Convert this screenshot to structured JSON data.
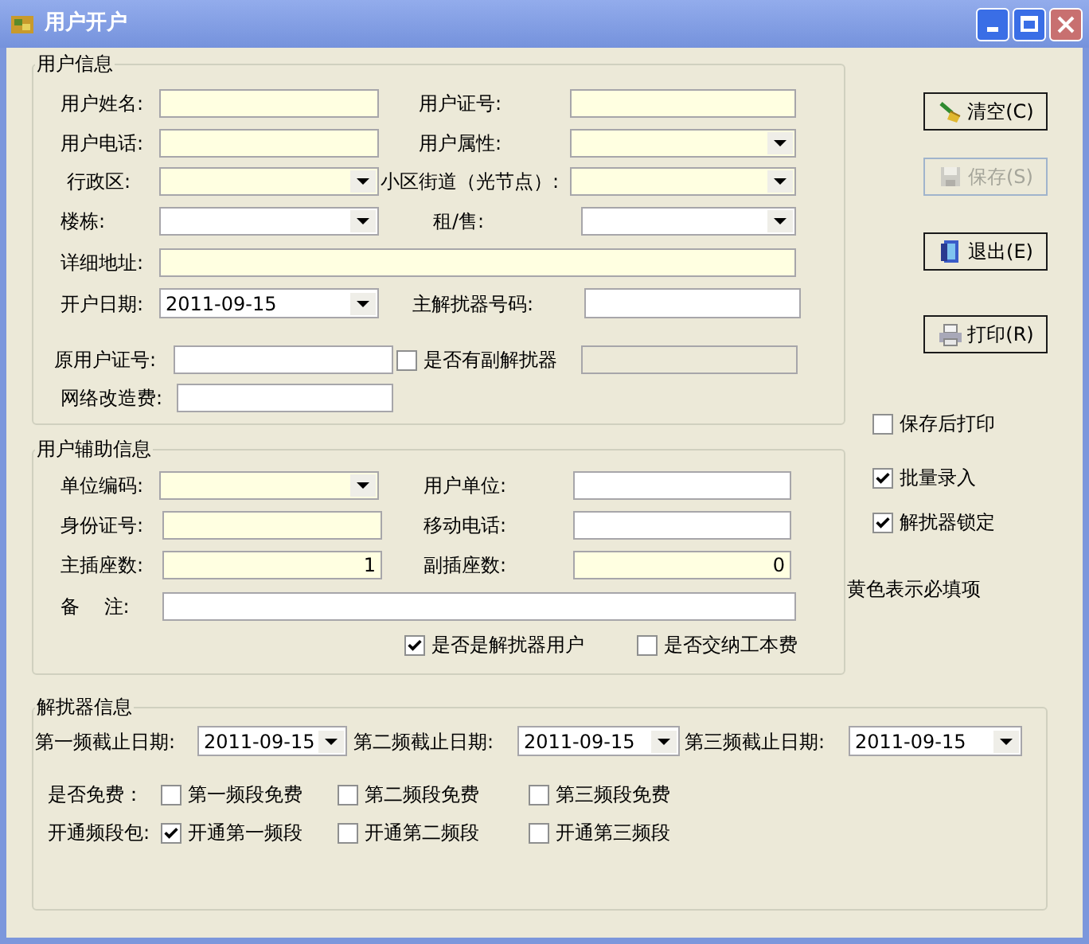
{
  "window": {
    "title": "用户开户"
  },
  "user_info": {
    "title": "用户信息",
    "fields": [
      {
        "label": "用户姓名:",
        "kind": "text",
        "required": true
      },
      {
        "label": "用户证号:",
        "kind": "text",
        "required": true
      },
      {
        "label": "用户电话:",
        "kind": "text",
        "required": true
      },
      {
        "label": "用户属性:",
        "kind": "combo",
        "required": true
      },
      {
        "label": "行政区:",
        "kind": "combo",
        "required": true
      },
      {
        "label": "小区街道（光节点）:",
        "kind": "combo",
        "required": true
      },
      {
        "label": "楼栋:",
        "kind": "combo",
        "required": false
      },
      {
        "label": "租/售:",
        "kind": "combo",
        "required": false
      },
      {
        "label": "详细地址:",
        "kind": "text",
        "required": true
      },
      {
        "label": "开户日期:",
        "kind": "combo",
        "required": false,
        "value": "2011-09-15"
      },
      {
        "label": "主解扰器号码:",
        "kind": "text",
        "required": false
      },
      {
        "label": "原用户证号:",
        "kind": "text",
        "required": false
      },
      {
        "label": "是否有副解扰器",
        "kind": "checkbox",
        "checked": false
      },
      {
        "kind": "text",
        "disabled": true
      },
      {
        "label": "网络改造费:",
        "kind": "text",
        "required": false
      }
    ]
  },
  "aux_info": {
    "title": "用户辅助信息",
    "fields": [
      {
        "label": "单位编码:",
        "kind": "combo",
        "required": true
      },
      {
        "label": "用户单位:",
        "kind": "text",
        "required": false
      },
      {
        "label": "身份证号:",
        "kind": "text",
        "required": true
      },
      {
        "label": "移动电话:",
        "kind": "text",
        "required": false
      },
      {
        "label": "主插座数:",
        "kind": "number",
        "required": true,
        "value": "1"
      },
      {
        "label": "副插座数:",
        "kind": "number",
        "required": true,
        "value": "0"
      },
      {
        "label": "备    注:",
        "kind": "text",
        "required": false
      },
      {
        "label": "是否是解扰器用户",
        "kind": "checkbox",
        "checked": true
      },
      {
        "label": "是否交纳工本费",
        "kind": "checkbox",
        "checked": false
      }
    ]
  },
  "buttons": [
    {
      "label": "清空(C)",
      "disabled": false
    },
    {
      "label": "保存(S)",
      "disabled": true
    },
    {
      "label": "退出(E)",
      "disabled": false
    },
    {
      "label": "打印(R)",
      "disabled": false
    }
  ],
  "options": [
    {
      "label": "保存后打印",
      "checked": false
    },
    {
      "label": "批量录入",
      "checked": true
    },
    {
      "label": "解扰器锁定",
      "checked": true
    }
  ],
  "note": "黄色表示必填项",
  "descrambler_info": {
    "title": "解扰器信息",
    "fields": [
      {
        "label": "第一频截止日期:",
        "kind": "combo",
        "required": false,
        "value": "2011-09-15"
      },
      {
        "label": "第二频截止日期:",
        "kind": "combo",
        "required": false,
        "value": "2011-09-15"
      },
      {
        "label": "第三频截止日期:",
        "kind": "combo",
        "required": false,
        "value": "2011-09-15"
      }
    ],
    "free": {
      "label": "是否免费：",
      "options": [
        {
          "label": "第一频段免费",
          "checked": false
        },
        {
          "label": "第二频段免费",
          "checked": false
        },
        {
          "label": "第三频段免费",
          "checked": false
        }
      ]
    },
    "packages": {
      "label": "开通频段包:",
      "options": [
        {
          "label": "开通第一频段",
          "checked": true
        },
        {
          "label": "开通第二频段",
          "checked": false
        },
        {
          "label": "开通第三频段",
          "checked": false
        }
      ]
    }
  }
}
